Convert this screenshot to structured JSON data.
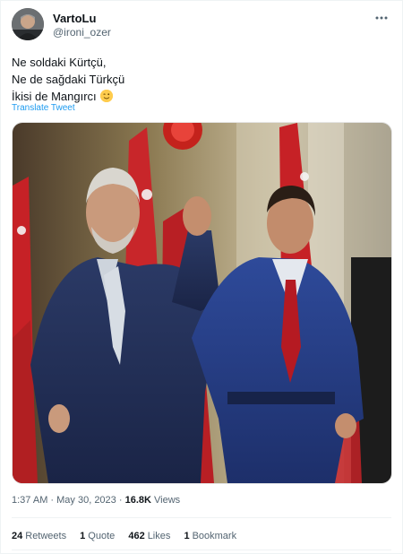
{
  "tweet": {
    "author_name": "VartoLu",
    "author_handle": "@ironi_ozer",
    "lines": [
      "Ne soldaki Kürtçü,",
      "Ne de sağdaki Türkçü",
      "İkisi de Mangırcı"
    ],
    "emoji_icon": "winking-face-emoji",
    "translate_label": "Translate Tweet",
    "timestamp": "1:37 AM · May 30, 2023",
    "separator": "·",
    "views_count": "16.8K",
    "views_label": "Views"
  },
  "stats": [
    {
      "count": "24",
      "label": "Retweets"
    },
    {
      "count": "1",
      "label": "Quote"
    },
    {
      "count": "462",
      "label": "Likes"
    },
    {
      "count": "1",
      "label": "Bookmark"
    }
  ],
  "colors": {
    "link": "#1d9bf0",
    "secondary_text": "#536471",
    "primary_text": "#0f1419",
    "divider": "#eff3f4"
  },
  "icons": {
    "more": "more-options-icon"
  }
}
